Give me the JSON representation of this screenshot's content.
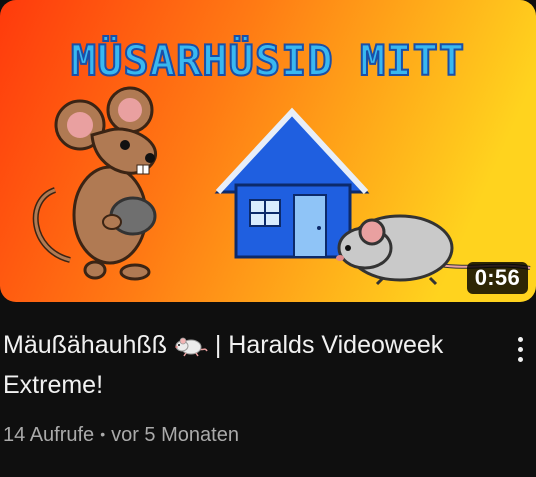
{
  "video": {
    "thumbnail_text": "MÜSARHÜSID MITT",
    "duration": "0:56",
    "title_part1": "Mäußähauhßß",
    "title_emoji": "rat-emoji",
    "title_part2": " | Haralds Videoweek Extreme!",
    "views": "14 Aufrufe",
    "separator": "•",
    "age": "vor 5 Monaten"
  },
  "menu": {
    "icon": "kebab-menu-icon"
  },
  "colors": {
    "background": "#0f0f0f",
    "title_text": "#f1f1f1",
    "meta_text": "#aaaaaa",
    "thumb_gradient_start": "#ff3d0a",
    "thumb_gradient_end": "#ffd21f",
    "house_blue": "#1f5fe0"
  }
}
